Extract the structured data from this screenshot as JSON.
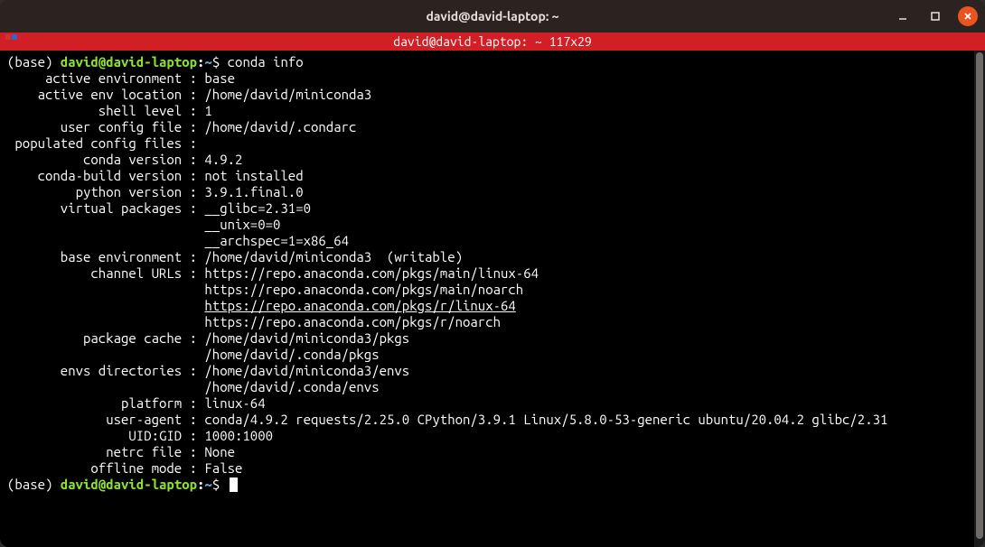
{
  "colors": {
    "titlebar_bg": "#2b2320",
    "close_btn": "#e95420",
    "dim_bar_bg": "#d21f26",
    "prompt_green": "#8ae234",
    "prompt_blue": "#729fcf"
  },
  "window": {
    "title": "david@david-laptop: ~"
  },
  "dimbar": {
    "text": "david@david-laptop: ~ 117x29"
  },
  "prompt": {
    "base": "(base) ",
    "userhost": "david@david-laptop",
    "colon": ":",
    "path": "~",
    "dollar": "$ "
  },
  "command": "conda info",
  "info": {
    "active_environment": {
      "label": "     active environment : ",
      "value": "base"
    },
    "active_env_location": {
      "label": "    active env location : ",
      "value": "/home/david/miniconda3"
    },
    "shell_level": {
      "label": "            shell level : ",
      "value": "1"
    },
    "user_config_file": {
      "label": "       user config file : ",
      "value": "/home/david/.condarc"
    },
    "populated_config_files": {
      "label": " populated config files : ",
      "value": ""
    },
    "conda_version": {
      "label": "          conda version : ",
      "value": "4.9.2"
    },
    "conda_build_version": {
      "label": "    conda-build version : ",
      "value": "not installed"
    },
    "python_version": {
      "label": "         python version : ",
      "value": "3.9.1.final.0"
    },
    "virtual_packages": {
      "label": "       virtual packages : ",
      "values": [
        "__glibc=2.31=0",
        "__unix=0=0",
        "__archspec=1=x86_64"
      ]
    },
    "base_environment": {
      "label": "       base environment : ",
      "value": "/home/david/miniconda3  (writable)"
    },
    "channel_urls": {
      "label": "           channel URLs : ",
      "values": [
        "https://repo.anaconda.com/pkgs/main/linux-64",
        "https://repo.anaconda.com/pkgs/main/noarch",
        "https://repo.anaconda.com/pkgs/r/linux-64",
        "https://repo.anaconda.com/pkgs/r/noarch"
      ],
      "underlined_index": 2
    },
    "package_cache": {
      "label": "          package cache : ",
      "values": [
        "/home/david/miniconda3/pkgs",
        "/home/david/.conda/pkgs"
      ]
    },
    "envs_directories": {
      "label": "       envs directories : ",
      "values": [
        "/home/david/miniconda3/envs",
        "/home/david/.conda/envs"
      ]
    },
    "platform": {
      "label": "               platform : ",
      "value": "linux-64"
    },
    "user_agent": {
      "label": "             user-agent : ",
      "value": "conda/4.9.2 requests/2.25.0 CPython/3.9.1 Linux/5.8.0-53-generic ubuntu/20.04.2 glibc/2.31"
    },
    "uid_gid": {
      "label": "                UID:GID : ",
      "value": "1000:1000"
    },
    "netrc_file": {
      "label": "             netrc file : ",
      "value": "None"
    },
    "offline_mode": {
      "label": "           offline mode : ",
      "value": "False"
    }
  },
  "continuation_pad": "                          "
}
